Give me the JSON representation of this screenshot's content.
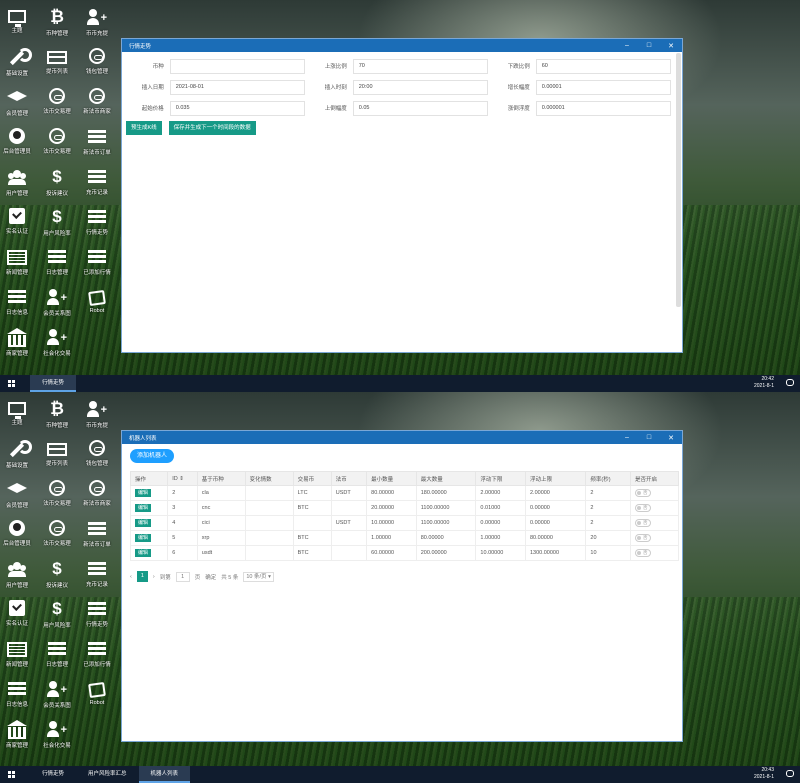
{
  "desktop_icons": [
    {
      "label": "主题",
      "icon": "monitor-icon"
    },
    {
      "label": "币种管理",
      "icon": "bitcoin-icon"
    },
    {
      "label": "币币充提",
      "icon": "user-plus-icon"
    },
    {
      "label": "基础设置",
      "icon": "wrench-icon"
    },
    {
      "label": "提币列表",
      "icon": "card-icon"
    },
    {
      "label": "钱包管理",
      "icon": "link-icon"
    },
    {
      "label": "会员管理",
      "icon": "mortarboard-icon"
    },
    {
      "label": "法币交易理",
      "icon": "link-icon"
    },
    {
      "label": "新法币商家",
      "icon": "link-icon"
    },
    {
      "label": "后台管理员",
      "icon": "face-icon"
    },
    {
      "label": "法币交易理",
      "icon": "link-icon"
    },
    {
      "label": "新法币订单",
      "icon": "list-icon"
    },
    {
      "label": "用户管理",
      "icon": "group-icon"
    },
    {
      "label": "投诉建议",
      "icon": "dollar-icon"
    },
    {
      "label": "充币记录",
      "icon": "list-icon"
    },
    {
      "label": "实名认证",
      "icon": "check-icon"
    },
    {
      "label": "用户风险率",
      "icon": "dollar-icon"
    },
    {
      "label": "行情走势",
      "icon": "list-icon"
    },
    {
      "label": "新闻管理",
      "icon": "news-icon"
    },
    {
      "label": "日志管理",
      "icon": "list-icon"
    },
    {
      "label": "已添加行情",
      "icon": "list-icon"
    },
    {
      "label": "日志信息",
      "icon": "list-icon"
    },
    {
      "label": "会员关系图",
      "icon": "user-plus-icon"
    },
    {
      "label": "Robot",
      "icon": "robot-icon"
    },
    {
      "label": "商家管理",
      "icon": "bank-icon"
    },
    {
      "label": "社会化交易",
      "icon": "user-plus-icon"
    }
  ],
  "window1": {
    "title": "行情走势",
    "fields": [
      {
        "label": "币种",
        "value": ""
      },
      {
        "label": "上涨比例",
        "value": "70"
      },
      {
        "label": "下跌比例",
        "value": "60"
      },
      {
        "label": "插入日期",
        "value": "2021-08-01"
      },
      {
        "label": "插入时刻",
        "value": "20:00"
      },
      {
        "label": "增长幅度",
        "value": "0.00001"
      },
      {
        "label": "起始价格",
        "value": "0.035"
      },
      {
        "label": "上倒幅度",
        "value": "0.05"
      },
      {
        "label": "涨倒浮度",
        "value": "0.000001"
      }
    ],
    "buttons": [
      "预生成K线",
      "保存并生成下一个时间段的数据"
    ]
  },
  "window2": {
    "title": "机器人列表",
    "add_button": "添加机器人",
    "columns": [
      "操作",
      "ID ⇕",
      "基于币种",
      "变化情数",
      "交易币",
      "法币",
      "最小数量",
      "最大数量",
      "浮动下限",
      "浮动上限",
      "频率(秒)",
      "是否开启"
    ],
    "edit_label": "编辑",
    "toggle_label": "否",
    "rows": [
      [
        "2",
        "cla",
        "",
        "LTC",
        "USDT",
        "80.00000",
        "180.00000",
        "2.00000",
        "2.00000",
        "2"
      ],
      [
        "3",
        "cnc",
        "",
        "BTC",
        "",
        "20.00000",
        "1100.00000",
        "0.01000",
        "0.00000",
        "2"
      ],
      [
        "4",
        "cici",
        "",
        "",
        "USDT",
        "10.00000",
        "1100.00000",
        "0.00000",
        "0.00000",
        "2"
      ],
      [
        "5",
        "xrp",
        "",
        "BTC",
        "",
        "1.00000",
        "80.00000",
        "1.00000",
        "80.00000",
        "20"
      ],
      [
        "6",
        "usdt",
        "",
        "BTC",
        "",
        "60.00000",
        "200.00000",
        "10.00000",
        "1300.00000",
        "10"
      ]
    ],
    "pager": {
      "prev": "‹",
      "current": "1",
      "next": "›",
      "goto_label": "到第",
      "goto_value": "1",
      "page_unit": "页",
      "confirm": "确定",
      "total": "共 5 条",
      "per_page": "10 条/页"
    }
  },
  "taskbar1": {
    "tasks": [
      "行情走势"
    ],
    "time": "20:42",
    "date": "2021-8-1"
  },
  "taskbar2": {
    "tasks": [
      "行情走势",
      "用户风险率汇总",
      "机器人列表"
    ],
    "time": "20:43",
    "date": "2021-8-1"
  },
  "window_controls": {
    "minimize": "–",
    "maximize": "□",
    "close": "✕"
  },
  "colors": {
    "titlebar": "#1b6db7",
    "green_button": "#169a87",
    "blue_button": "#1e9fff",
    "taskbar": "#101c2e"
  }
}
